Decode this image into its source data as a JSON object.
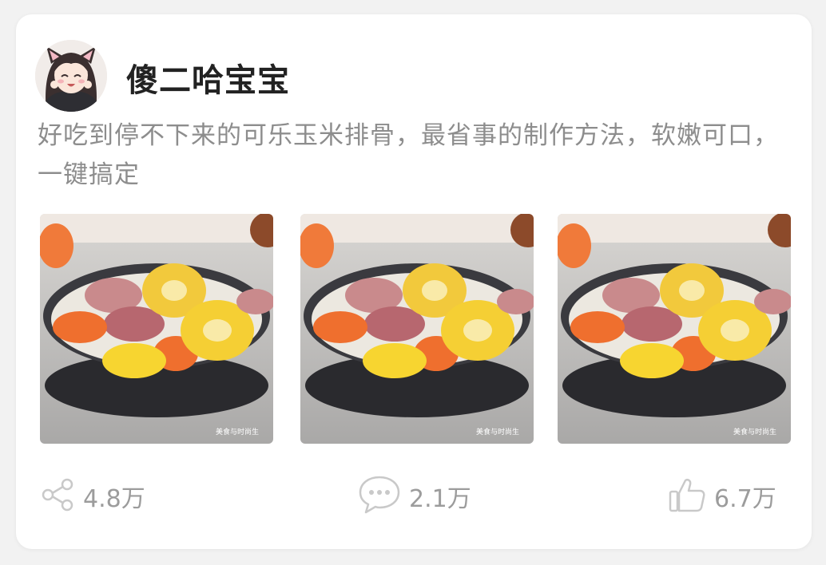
{
  "post": {
    "author": "傻二哈宝宝",
    "text": "好吃到停不下来的可乐玉米排骨，最省事的制作方法，软嫩可口，一键搞定",
    "images": [
      {
        "watermark": "美食与时尚生"
      },
      {
        "watermark": "美食与时尚生"
      },
      {
        "watermark": "美食与时尚生"
      }
    ]
  },
  "actions": {
    "share": {
      "icon": "share-icon",
      "count": "4.8万"
    },
    "comment": {
      "icon": "comment-bubble-icon",
      "count": "2.1万"
    },
    "like": {
      "icon": "thumbs-up-icon",
      "count": "6.7万"
    }
  },
  "colors": {
    "author_text": "#222222",
    "body_text": "#8d8d8d",
    "action_text": "#9c9c9c",
    "icon_stroke": "#c9c9c9"
  }
}
